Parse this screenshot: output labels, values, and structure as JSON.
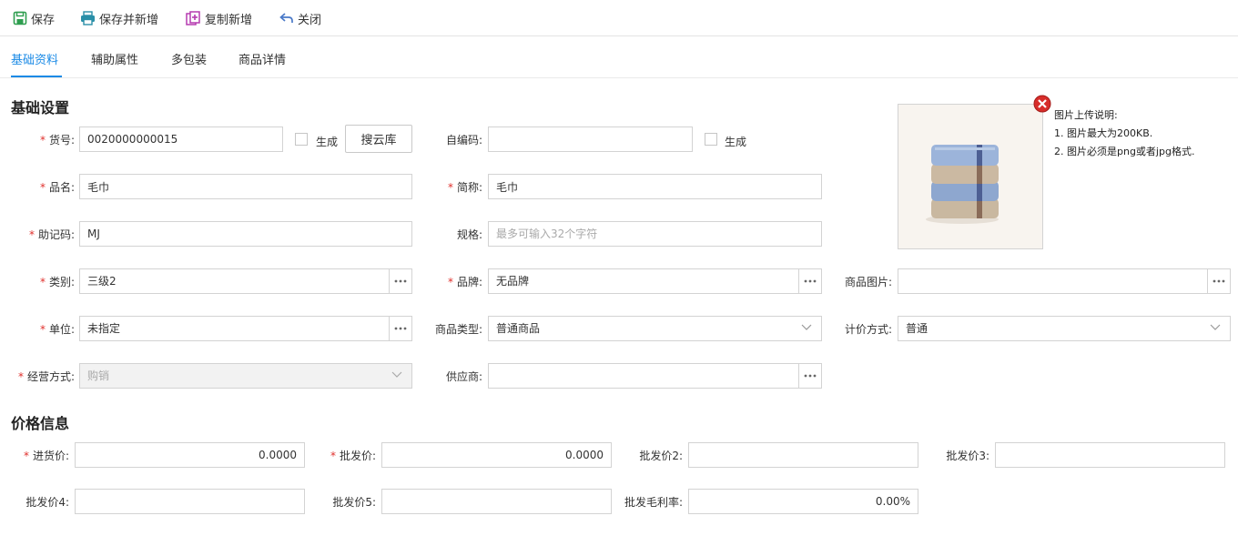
{
  "toolbar": {
    "save": "保存",
    "save_new": "保存并新增",
    "copy_new": "复制新增",
    "close": "关闭"
  },
  "tabs": [
    "基础资料",
    "辅助属性",
    "多包装",
    "商品详情"
  ],
  "sections": {
    "basic": "基础设置",
    "price": "价格信息"
  },
  "fields": {
    "sku": {
      "label": "货号:",
      "value": "0020000000015",
      "generate": "生成",
      "cloud_button": "搜云库"
    },
    "barcode": {
      "label": "自编码:",
      "value": "",
      "generate": "生成"
    },
    "name": {
      "label": "品名:",
      "value": "毛巾"
    },
    "short_name": {
      "label": "简称:",
      "value": "毛巾"
    },
    "mnemonic": {
      "label": "助记码:",
      "value": "MJ"
    },
    "spec": {
      "label": "规格:",
      "value": "",
      "placeholder": "最多可输入32个字符"
    },
    "category": {
      "label": "类别:",
      "value": "三级2"
    },
    "brand": {
      "label": "品牌:",
      "value": "无品牌"
    },
    "product_image": {
      "label": "商品图片:",
      "value": ""
    },
    "unit": {
      "label": "单位:",
      "value": "未指定"
    },
    "product_type": {
      "label": "商品类型:",
      "value": "普通商品"
    },
    "pricing_method": {
      "label": "计价方式:",
      "value": "普通"
    },
    "operation_mode": {
      "label": "经营方式:",
      "value": "购销"
    },
    "supplier": {
      "label": "供应商:",
      "value": ""
    }
  },
  "prices": {
    "purchase": {
      "label": "进货价:",
      "value": "0.0000"
    },
    "wholesale": {
      "label": "批发价:",
      "value": "0.0000"
    },
    "wholesale2": {
      "label": "批发价2:",
      "value": ""
    },
    "wholesale3": {
      "label": "批发价3:",
      "value": ""
    },
    "wholesale4": {
      "label": "批发价4:",
      "value": ""
    },
    "wholesale5": {
      "label": "批发价5:",
      "value": ""
    },
    "margin": {
      "label": "批发毛利率:",
      "value": "0.00%"
    }
  },
  "image_notes": {
    "title": "图片上传说明:",
    "line1": "1. 图片最大为200KB.",
    "line2": "2. 图片必须是png或者jpg格式."
  },
  "colors": {
    "accent": "#1a8ae6",
    "required": "#e0302c"
  }
}
